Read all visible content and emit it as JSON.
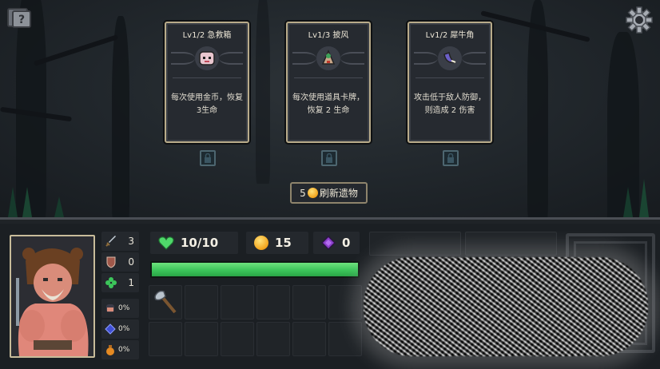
{
  "relics": [
    {
      "title": "Lv1/2 急救箱",
      "description": "每次使用金币，恢复3生命",
      "icon": "first-aid-kit-icon"
    },
    {
      "title": "Lv1/3 披风",
      "description": "每次使用道具卡牌，恢复 2 生命",
      "icon": "cloak-icon"
    },
    {
      "title": "Lv1/2 犀牛角",
      "description": "攻击低于敌人防御，则造成 2 伤害",
      "icon": "rhino-horn-icon"
    }
  ],
  "refresh": {
    "cost": "5",
    "label": "刷新遗物"
  },
  "stats": {
    "attack": "3",
    "defense": "0",
    "luck": "1"
  },
  "resistances": [
    {
      "icon": "fist-icon",
      "value": "0%"
    },
    {
      "icon": "blue-gem-icon",
      "value": "0%"
    },
    {
      "icon": "potion-icon",
      "value": "0%"
    }
  ],
  "health": {
    "text": "10/10",
    "fraction": 1.0
  },
  "gold": "15",
  "gems": "0",
  "inventory": {
    "items": [
      "axe-icon"
    ]
  },
  "colors": {
    "health": "#3cc55a",
    "card_border": "#b8ab8a",
    "gem": "#8a3fc9",
    "gold": "#f2a31b"
  }
}
